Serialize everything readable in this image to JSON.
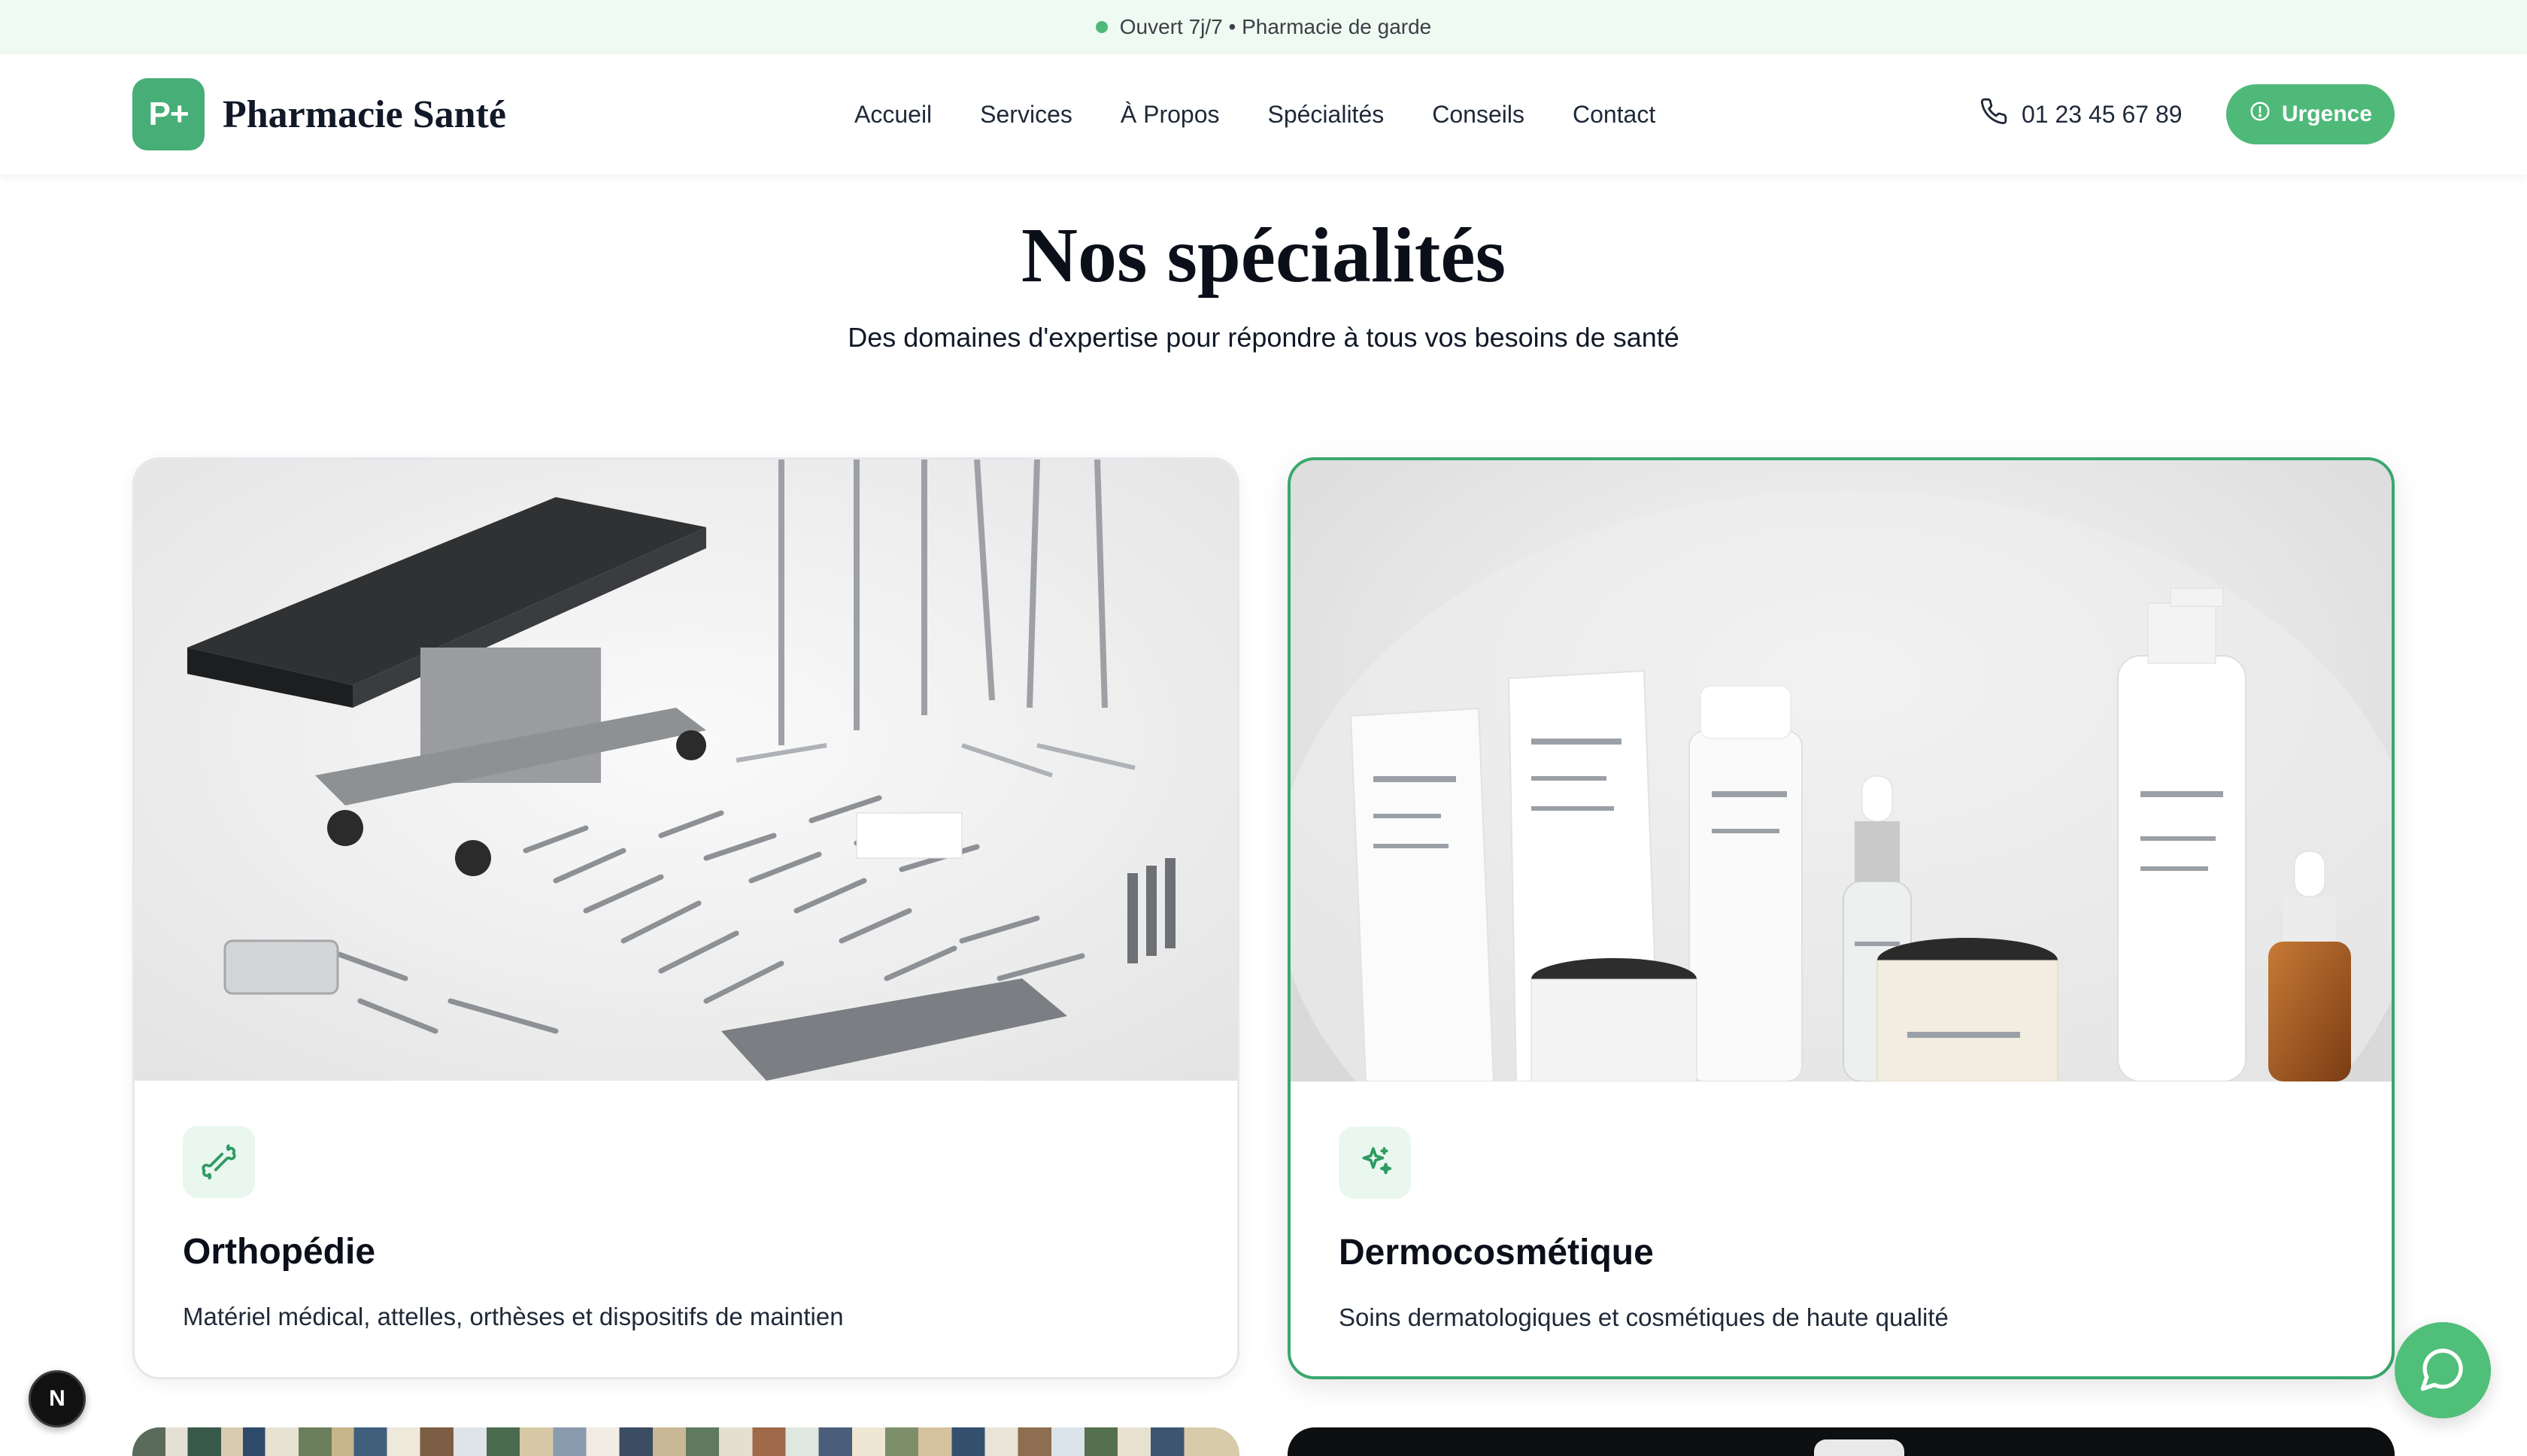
{
  "topbar": {
    "status_text": "Ouvert 7j/7 • Pharmacie de garde",
    "status_color": "#4fb97a"
  },
  "header": {
    "logo_mark": "P+",
    "logo_text": "Pharmacie Santé",
    "nav": [
      "Accueil",
      "Services",
      "À Propos",
      "Spécialités",
      "Conseils",
      "Contact"
    ],
    "phone": "01 23 45 67 89",
    "urgence_label": "Urgence",
    "accent": "#4fb97a"
  },
  "section": {
    "title": "Nos spécialités",
    "subtitle": "Des domaines d'expertise pour répondre à tous vos besoins de santé"
  },
  "cards": [
    {
      "icon": "wrench-bone-icon",
      "title": "Orthopédie",
      "description": "Matériel médical, attelles, orthèses et dispositifs de maintien"
    },
    {
      "icon": "sparkles-icon",
      "title": "Dermocosmétique",
      "description": "Soins dermatologiques et cosmétiques de haute qualité"
    }
  ],
  "floating": {
    "chat_icon": "chat-bubble-icon",
    "badge_letter": "N"
  }
}
